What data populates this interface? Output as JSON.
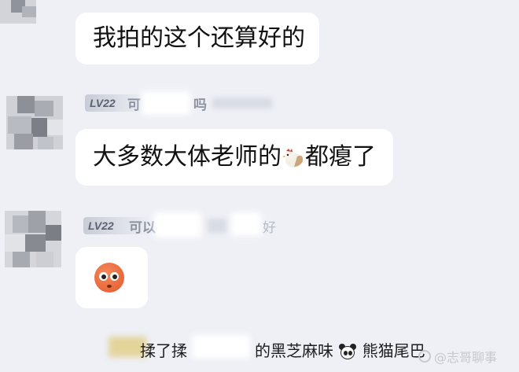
{
  "messages": [
    {
      "text": "我拍的这个还算好的"
    },
    {
      "level": "LV22",
      "nick_fragment": "可",
      "nick_tail": "吗",
      "text_before": "大多数大体老师的",
      "emoji": "chicken-emoji",
      "text_after": "都瘪了"
    },
    {
      "level": "LV22",
      "nick_fragment": "可以",
      "nick_tail": "好",
      "emoji": "sad-face-emoji"
    }
  ],
  "footer": {
    "part1": "揉了揉",
    "part2": "的黑芝麻味",
    "part3": "熊猫尾巴",
    "emoji": "panda-emoji"
  },
  "watermark": {
    "text": "@志哥聊事"
  },
  "colors": {
    "background": "#eef0f6",
    "bubble": "#ffffff",
    "level_text": "#5b6272"
  }
}
